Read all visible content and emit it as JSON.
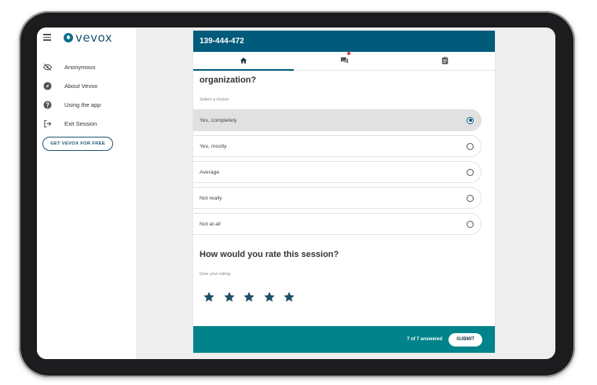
{
  "sidebar": {
    "brand": "vevox",
    "items": [
      {
        "label": "Anonymous",
        "icon": "eye-off-icon"
      },
      {
        "label": "About Vevox",
        "icon": "compass-icon"
      },
      {
        "label": "Using the app",
        "icon": "help-icon"
      },
      {
        "label": "Exit Session",
        "icon": "exit-icon"
      }
    ],
    "cta_label": "GET VEVOX FOR FREE"
  },
  "header": {
    "session_id": "139-444-472"
  },
  "tabs": [
    {
      "icon": "home-icon",
      "active": true
    },
    {
      "icon": "chat-icon",
      "notification": true
    },
    {
      "icon": "clipboard-icon"
    }
  ],
  "question1": {
    "title": "organization?",
    "hint": "Select a choice.",
    "choices": [
      "Yes, completely",
      "Yes, mostly",
      "Average",
      "Not really",
      "Not at all"
    ],
    "selected_index": 0
  },
  "question2": {
    "title": "How would you rate this session?",
    "hint": "Give your rating.",
    "star_count": 5
  },
  "footer": {
    "answered": "7 of 7 answered",
    "submit_label": "SUBMIT"
  },
  "colors": {
    "primary": "#005b7a",
    "footer": "#00838a",
    "notification": "#e8333b"
  }
}
